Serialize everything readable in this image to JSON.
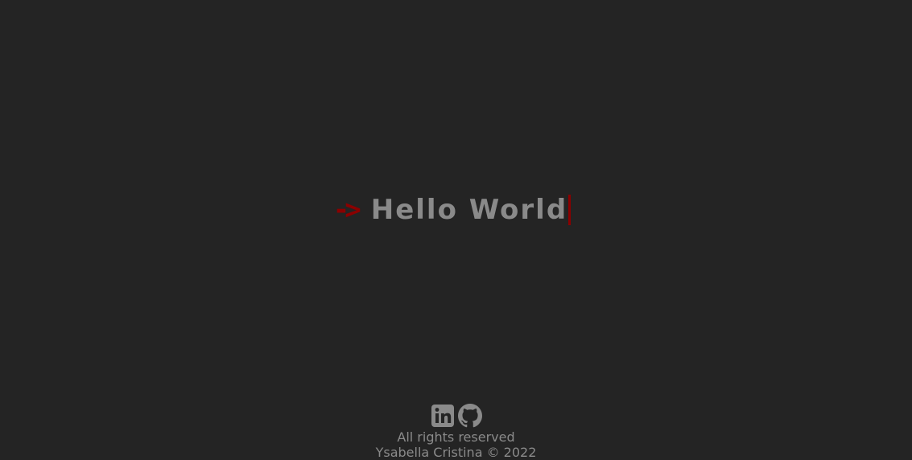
{
  "hero": {
    "arrow": "->",
    "text": "Hello World"
  },
  "footer": {
    "social": [
      {
        "icon": "linkedin-icon"
      },
      {
        "icon": "github-icon"
      }
    ],
    "rights": "All rights reserved",
    "credit": "Ysabella Cristina © 2022"
  },
  "colors": {
    "background": "#242424",
    "accent": "#8b0000",
    "text": "#8a8a8a"
  }
}
